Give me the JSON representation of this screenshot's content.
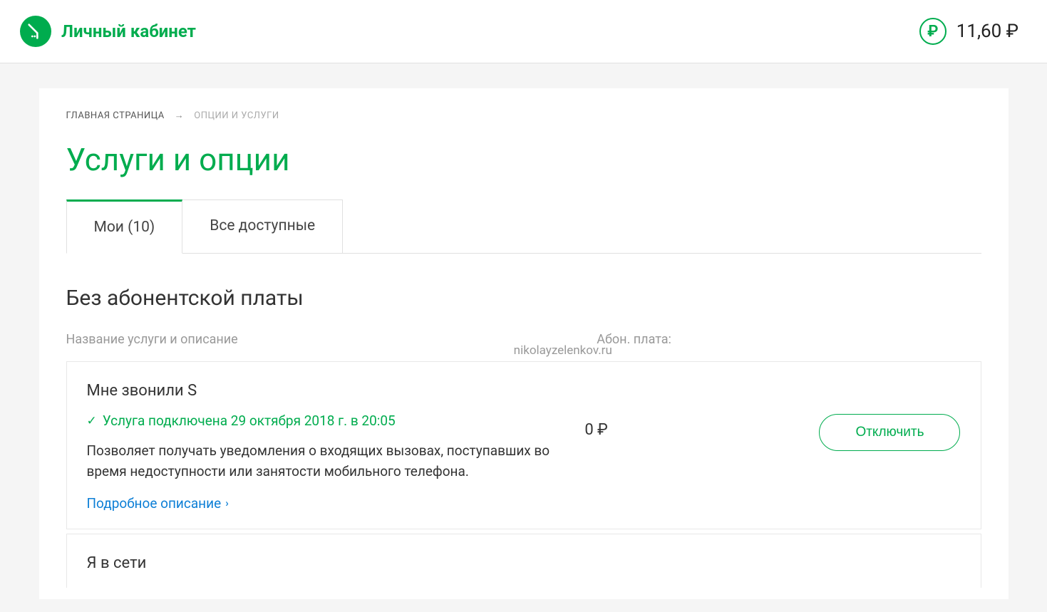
{
  "header": {
    "logo_text": "Личный кабинет",
    "balance": "11,60 ₽"
  },
  "breadcrumb": {
    "home": "ГЛАВНАЯ СТРАНИЦА",
    "arrow": "→",
    "current": "ОПЦИИ И УСЛУГИ"
  },
  "page_title": "Услуги и опции",
  "tabs": {
    "mine": "Мои (10)",
    "all": "Все доступные"
  },
  "watermark": "nikolayzelenkov.ru",
  "section": {
    "title": "Без абонентской платы",
    "col_name": "Название услуги и описание",
    "col_fee": "Абон. плата:"
  },
  "services": [
    {
      "name": "Мне звонили S",
      "status": "Услуга подключена 29 октября 2018 г. в 20:05",
      "description": "Позволяет получать уведомления о входящих вызовах, поступавших во время недоступности или занятости мобильного телефона.",
      "link": "Подробное описание",
      "fee": "0 ₽",
      "action": "Отключить"
    },
    {
      "name": "Я в сети"
    }
  ]
}
